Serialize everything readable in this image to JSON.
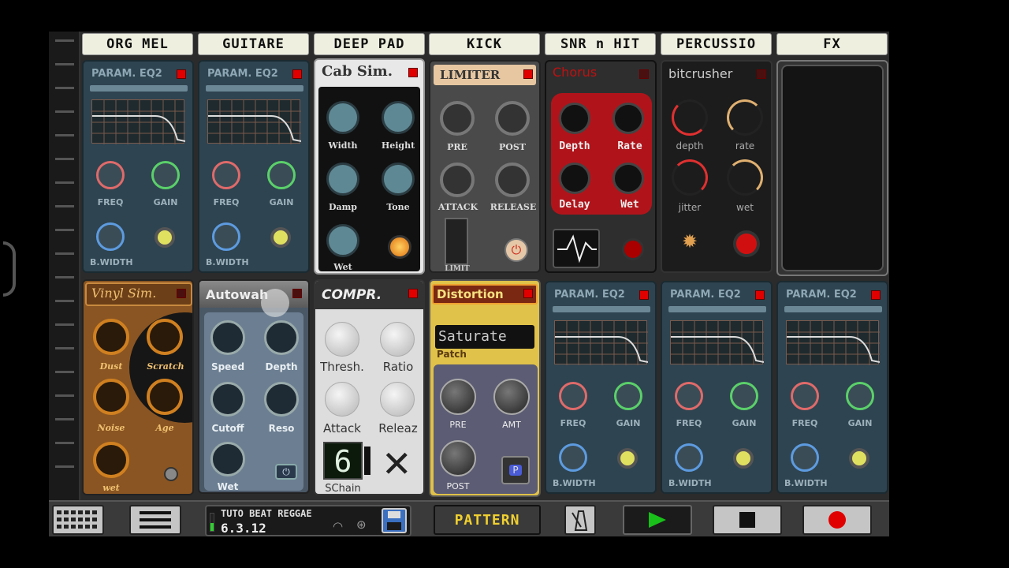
{
  "tabs": [
    "ORG MEL",
    "GUITARE",
    "DEEP PAD",
    "KICK",
    "SNR n HIT",
    "PERCUSSIO",
    "FX"
  ],
  "eq": {
    "title": "PARAM. EQ2",
    "freq": "FREQ",
    "gain": "GAIN",
    "bw": "B.WIDTH"
  },
  "cab": {
    "title": "Cab Sim.",
    "k": [
      "Width",
      "Height",
      "Damp",
      "Tone",
      "Wet"
    ]
  },
  "limiter": {
    "title": "LIMITER",
    "k": [
      "PRE",
      "POST",
      "ATTACK",
      "RELEASE"
    ],
    "limit": "LIMIT"
  },
  "chorus": {
    "title": "Chorus",
    "k": [
      "Depth",
      "Rate",
      "Delay",
      "Wet"
    ]
  },
  "bitcrusher": {
    "title": "bitcrusher",
    "k": [
      "depth",
      "rate",
      "jitter",
      "wet"
    ]
  },
  "vinyl": {
    "title": "Vinyl Sim.",
    "k": [
      "Dust",
      "Scratch",
      "Noise",
      "Age",
      "wet"
    ]
  },
  "autowah": {
    "title": "Autowah",
    "k": [
      "Speed",
      "Depth",
      "Cutoff",
      "Reso",
      "Wet"
    ]
  },
  "compr": {
    "title": "COMPR.",
    "k": [
      "Thresh.",
      "Ratio",
      "Attack",
      "Releaz"
    ],
    "schain": "SChain",
    "digit": "6"
  },
  "dist": {
    "title": "Distortion",
    "preset": "Saturate",
    "patch": "Patch",
    "k": [
      "PRE",
      "AMT",
      "POST"
    ],
    "p": "P"
  },
  "song": {
    "name": "TUTO BEAT REGGAE",
    "version": "6.3.12"
  },
  "pattern": "PATTERN",
  "colors": {
    "led": "#e10000",
    "play": "#19c019",
    "record": "#e00000",
    "pattern_text": "#f0d030"
  }
}
